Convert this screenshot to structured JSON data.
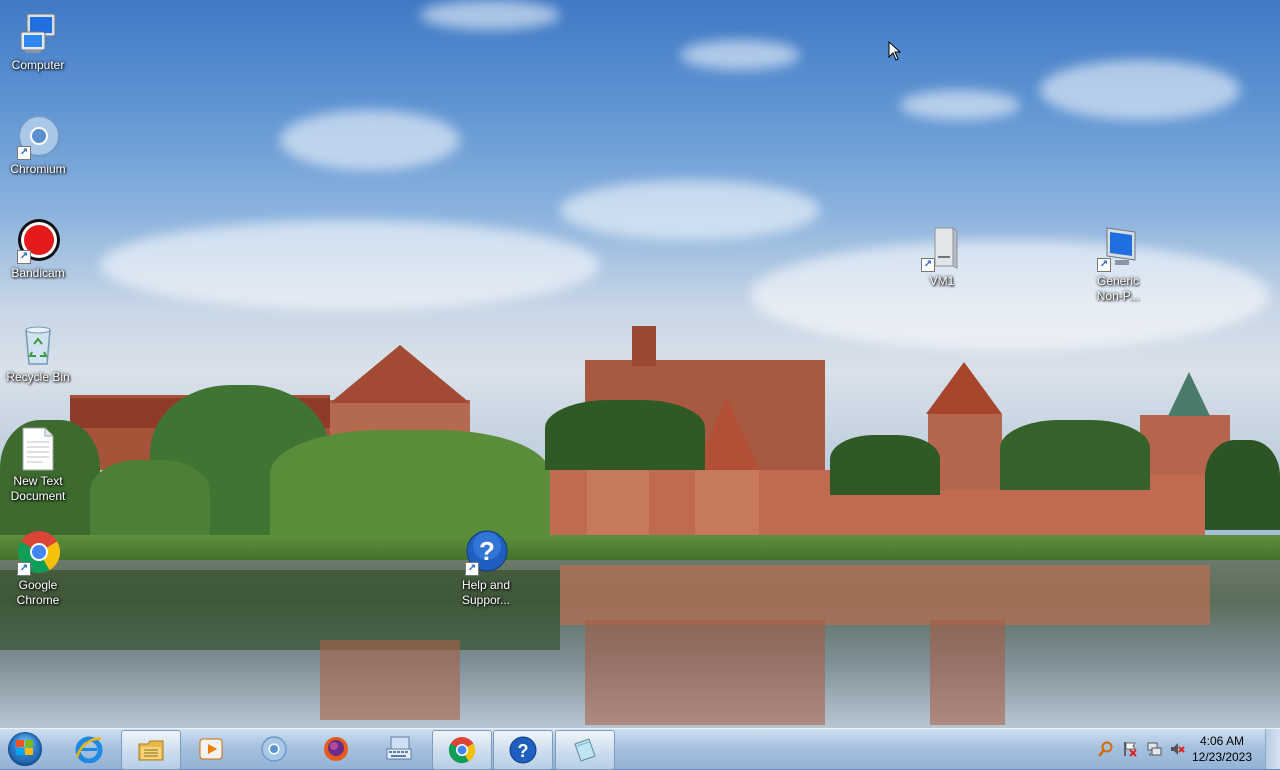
{
  "desktop": {
    "icons": [
      {
        "label": "Computer",
        "icon": "computer-icon"
      },
      {
        "label": "Chromium",
        "icon": "chromium-icon"
      },
      {
        "label": "Bandicam",
        "icon": "bandicam-icon"
      },
      {
        "label": "Recycle Bin",
        "icon": "recycle-bin-icon"
      },
      {
        "label": "New Text\nDocument",
        "icon": "text-document-icon"
      },
      {
        "label": "Google\nChrome",
        "icon": "chrome-icon"
      },
      {
        "label": "Help and\nSuppor...",
        "icon": "help-icon"
      },
      {
        "label": "VM1",
        "icon": "drive-icon"
      },
      {
        "label": "Generic\nNon-P...",
        "icon": "monitor-icon"
      }
    ]
  },
  "taskbar": {
    "start_icon": "windows-start-orb",
    "buttons": [
      {
        "icon": "internet-explorer-icon",
        "active": false
      },
      {
        "icon": "file-explorer-icon",
        "active": true
      },
      {
        "icon": "media-player-icon",
        "active": false
      },
      {
        "icon": "chromium-icon",
        "active": false
      },
      {
        "icon": "firefox-icon",
        "active": false
      },
      {
        "icon": "on-screen-keyboard-icon",
        "active": false
      },
      {
        "icon": "chrome-icon",
        "active": true
      },
      {
        "icon": "help-icon",
        "active": true
      },
      {
        "icon": "notepad-icon",
        "active": true
      }
    ],
    "tray": {
      "icons": [
        "search-tray-icon",
        "action-center-flag-icon",
        "network-icon",
        "volume-muted-icon"
      ],
      "time": "4:06 AM",
      "date": "12/23/2023"
    }
  },
  "colors": {
    "taskbar_top": "#d6e4f2",
    "taskbar_bottom": "#96b4d6",
    "icon_label": "#ffffff"
  }
}
